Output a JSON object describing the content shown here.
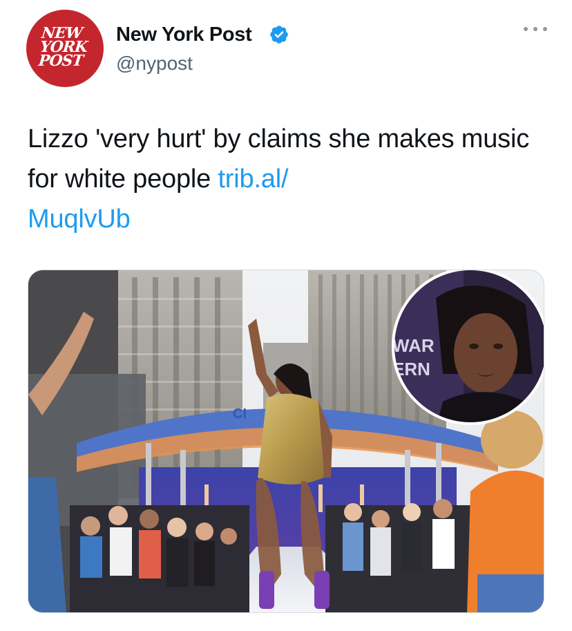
{
  "account": {
    "display_name": "New York Post",
    "handle": "@nypost",
    "verified": true,
    "avatar_text": [
      "NEW",
      "YORK",
      "POST"
    ],
    "avatar_color": "#c4262e"
  },
  "tweet": {
    "text": "Lizzo 'very hurt' by claims she makes music for white people ",
    "link_part1": "trib.al/",
    "link_part2": "MuqlvUb"
  },
  "media": {
    "inset_sign_text": [
      "WAR",
      "ERN"
    ],
    "stage_sign_text": "CI"
  },
  "icons": {
    "verified": "verified-badge-icon",
    "more": "more-options-icon"
  },
  "colors": {
    "link": "#1d9bf0",
    "verified": "#1d9bf0",
    "secondary_text": "#536471"
  }
}
